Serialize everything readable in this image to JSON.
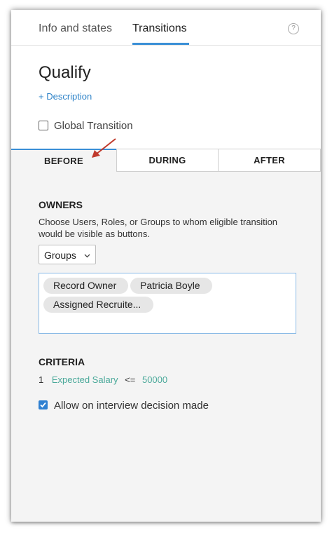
{
  "tabs": {
    "info_label": "Info and states",
    "transitions_label": "Transitions",
    "help_glyph": "?"
  },
  "transition": {
    "title": "Qualify",
    "description_link": "+ Description",
    "global_label": "Global Transition",
    "global_checked": false
  },
  "phases": {
    "before": "BEFORE",
    "during": "DURING",
    "after": "AFTER",
    "active": "before"
  },
  "owners": {
    "title": "OWNERS",
    "description": "Choose Users, Roles, or Groups to whom eligible transition would be visible as buttons.",
    "select_value": "Groups",
    "chips": [
      "Record Owner",
      "Patricia Boyle",
      "Assigned Recruite..."
    ]
  },
  "criteria": {
    "title": "CRITERIA",
    "number": "1",
    "field": "Expected Salary",
    "operator": "<=",
    "value": "50000"
  },
  "option": {
    "label": "Allow on interview decision made",
    "checked": true
  },
  "colors": {
    "accent": "#3a8fd6",
    "link": "#2e83c8",
    "criteria_value": "#4aa99a",
    "arrow": "#c0392b"
  },
  "icons": {
    "help": "help-circle-icon",
    "chevron": "chevron-down-icon",
    "annotation": "red-arrow-icon",
    "check": "checkmark-icon"
  }
}
